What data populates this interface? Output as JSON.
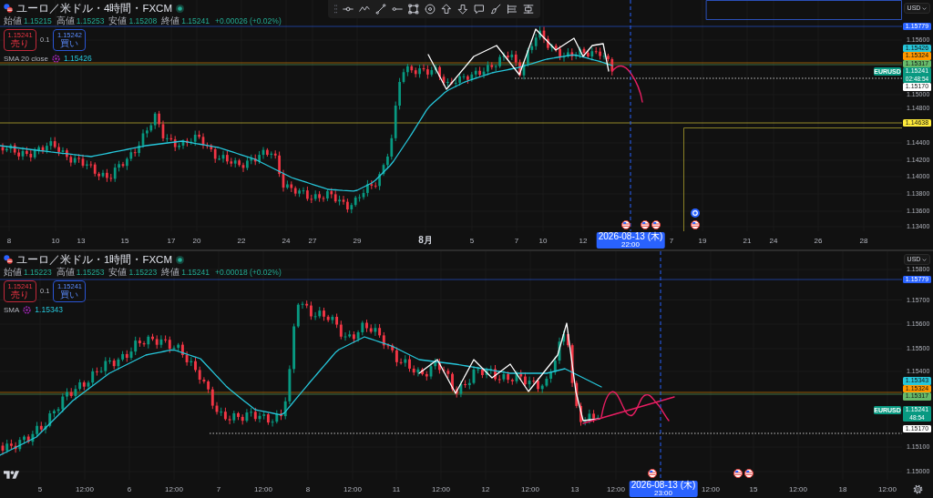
{
  "panels": [
    {
      "title": "ユーロ／米ドル・4時間・FXCM",
      "ohlc": [
        {
          "label": "始値",
          "value": "1.15215"
        },
        {
          "label": "高値",
          "value": "1.15253"
        },
        {
          "label": "安値",
          "value": "1.15208"
        },
        {
          "label": "終値",
          "value": "1.15241"
        }
      ],
      "change": "+0.00026 (+0.02%)",
      "sell": {
        "price": "1.15241",
        "label": "売り"
      },
      "lot": "0.1",
      "buy": {
        "price": "1.15242",
        "label": "買い"
      },
      "indicator": {
        "name": "SMA 20 close",
        "value": "1.15426"
      },
      "currency": "USD",
      "price_ticks": [
        "1.15600",
        "1.15000",
        "1.14800",
        "1.14400",
        "1.14200",
        "1.14000",
        "1.13800",
        "1.13600",
        "1.13400"
      ],
      "price_tags": [
        {
          "kind": "level",
          "price": "1.15779",
          "color": "#2962ff"
        },
        {
          "kind": "level",
          "price": "1.15426",
          "color": "#26c6da"
        },
        {
          "kind": "level",
          "price": "1.15324",
          "color": "#ff9800"
        },
        {
          "kind": "level",
          "price": "1.15317",
          "color": "#66bb6a"
        },
        {
          "kind": "symbol",
          "label": "EURUSD",
          "price": "1.15241",
          "countdown": "02:48:54",
          "color": "#089981"
        },
        {
          "kind": "level",
          "price": "1.15170",
          "color": "#ffffff"
        },
        {
          "kind": "level",
          "price": "1.14638",
          "color": "#ffeb3b"
        }
      ],
      "time_ticks": [
        {
          "label": "8",
          "kind": "tick"
        },
        {
          "label": "10",
          "kind": "tick"
        },
        {
          "label": "13",
          "kind": "tick"
        },
        {
          "label": "15",
          "kind": "tick"
        },
        {
          "label": "17",
          "kind": "tick"
        },
        {
          "label": "20",
          "kind": "tick"
        },
        {
          "label": "22",
          "kind": "tick"
        },
        {
          "label": "24",
          "kind": "tick"
        },
        {
          "label": "27",
          "kind": "tick"
        },
        {
          "label": "29",
          "kind": "tick"
        },
        {
          "label": "8月",
          "kind": "month"
        },
        {
          "label": "5",
          "kind": "tick"
        },
        {
          "label": "7",
          "kind": "tick"
        },
        {
          "label": "10",
          "kind": "tick"
        },
        {
          "label": "12",
          "kind": "tick"
        },
        {
          "label": "7",
          "kind": "tick"
        },
        {
          "label": "19",
          "kind": "tick"
        },
        {
          "label": "21",
          "kind": "tick"
        },
        {
          "label": "24",
          "kind": "tick"
        },
        {
          "label": "26",
          "kind": "tick"
        },
        {
          "label": "28",
          "kind": "tick"
        }
      ],
      "crosshair": {
        "date": "2026-08-13 (木)",
        "time": "22:00"
      }
    },
    {
      "title": "ユーロ／米ドル・1時間・FXCM",
      "ohlc": [
        {
          "label": "始値",
          "value": "1.15223"
        },
        {
          "label": "高値",
          "value": "1.15253"
        },
        {
          "label": "安値",
          "value": "1.15223"
        },
        {
          "label": "終値",
          "value": "1.15241"
        }
      ],
      "change": "+0.00018 (+0.02%)",
      "sell": {
        "price": "1.15241",
        "label": "売り"
      },
      "lot": "0.1",
      "buy": {
        "price": "1.15241",
        "label": "買い"
      },
      "indicator": {
        "name": "SMA",
        "value": "1.15343"
      },
      "currency": "USD",
      "price_ticks": [
        "1.15800",
        "1.15700",
        "1.15600",
        "1.15500",
        "1.15400",
        "1.15100",
        "1.15000"
      ],
      "price_tags": [
        {
          "kind": "level",
          "price": "1.15779",
          "color": "#2962ff"
        },
        {
          "kind": "level",
          "price": "1.15343",
          "color": "#26c6da"
        },
        {
          "kind": "level",
          "price": "1.15324",
          "color": "#ff9800"
        },
        {
          "kind": "level",
          "price": "1.15317",
          "color": "#66bb6a"
        },
        {
          "kind": "symbol",
          "label": "EURUSD",
          "price": "1.15241",
          "countdown": "48:54",
          "color": "#089981"
        },
        {
          "kind": "level",
          "price": "1.15170",
          "color": "#ffffff"
        }
      ],
      "time_ticks": [
        {
          "label": "5",
          "kind": "tick"
        },
        {
          "label": "12:00",
          "kind": "tick"
        },
        {
          "label": "6",
          "kind": "tick"
        },
        {
          "label": "12:00",
          "kind": "tick"
        },
        {
          "label": "7",
          "kind": "tick"
        },
        {
          "label": "12:00",
          "kind": "tick"
        },
        {
          "label": "8",
          "kind": "tick"
        },
        {
          "label": "12:00",
          "kind": "tick"
        },
        {
          "label": "11",
          "kind": "tick"
        },
        {
          "label": "12:00",
          "kind": "tick"
        },
        {
          "label": "12",
          "kind": "tick"
        },
        {
          "label": "12:00",
          "kind": "tick"
        },
        {
          "label": "13",
          "kind": "tick"
        },
        {
          "label": "12:00",
          "kind": "tick"
        },
        {
          "label": "12:00",
          "kind": "tick"
        },
        {
          "label": "15",
          "kind": "tick"
        },
        {
          "label": "12:00",
          "kind": "tick"
        },
        {
          "label": "18",
          "kind": "tick"
        },
        {
          "label": "12:00",
          "kind": "tick"
        }
      ],
      "crosshair": {
        "date": "2026-08-13 (木)",
        "time": "23:00"
      }
    }
  ]
}
